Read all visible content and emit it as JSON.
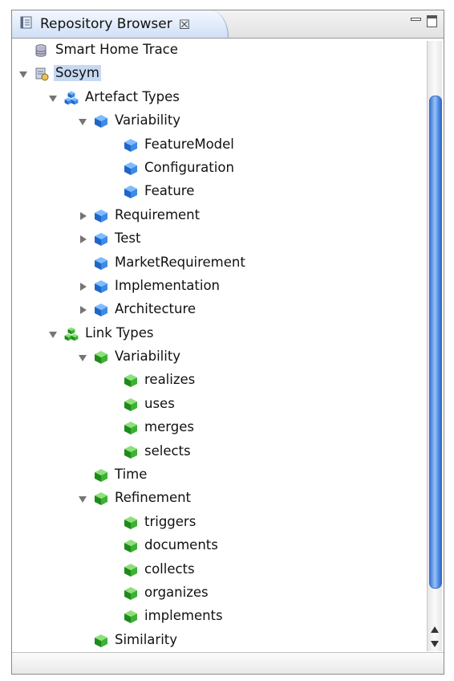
{
  "view": {
    "title": "Repository Browser",
    "title_icon": "repository-icon",
    "close_glyph": "☒",
    "controls": [
      "minimize-view",
      "maximize-view"
    ]
  },
  "tree": [
    {
      "label": "Smart Home Trace",
      "depth": 0,
      "icon": "database",
      "toggle": "none"
    },
    {
      "label": "Sosym",
      "depth": 0,
      "icon": "repository",
      "toggle": "open",
      "selected": true
    },
    {
      "label": "Artefact Types",
      "depth": 1,
      "icon": "blue-group",
      "toggle": "open"
    },
    {
      "label": "Variability",
      "depth": 2,
      "icon": "blue-cube",
      "toggle": "open"
    },
    {
      "label": "FeatureModel",
      "depth": 3,
      "icon": "blue-cube",
      "toggle": "none"
    },
    {
      "label": "Configuration",
      "depth": 3,
      "icon": "blue-cube",
      "toggle": "none"
    },
    {
      "label": "Feature",
      "depth": 3,
      "icon": "blue-cube",
      "toggle": "none"
    },
    {
      "label": "Requirement",
      "depth": 2,
      "icon": "blue-cube",
      "toggle": "closed"
    },
    {
      "label": "Test",
      "depth": 2,
      "icon": "blue-cube",
      "toggle": "closed"
    },
    {
      "label": "MarketRequirement",
      "depth": 2,
      "icon": "blue-cube",
      "toggle": "none"
    },
    {
      "label": "Implementation",
      "depth": 2,
      "icon": "blue-cube",
      "toggle": "closed"
    },
    {
      "label": "Architecture",
      "depth": 2,
      "icon": "blue-cube",
      "toggle": "closed"
    },
    {
      "label": "Link Types",
      "depth": 1,
      "icon": "green-group",
      "toggle": "open"
    },
    {
      "label": "Variability",
      "depth": 2,
      "icon": "green-cube",
      "toggle": "open"
    },
    {
      "label": "realizes",
      "depth": 3,
      "icon": "green-cube",
      "toggle": "none"
    },
    {
      "label": "uses",
      "depth": 3,
      "icon": "green-cube",
      "toggle": "none"
    },
    {
      "label": "merges",
      "depth": 3,
      "icon": "green-cube",
      "toggle": "none"
    },
    {
      "label": "selects",
      "depth": 3,
      "icon": "green-cube",
      "toggle": "none"
    },
    {
      "label": "Time",
      "depth": 2,
      "icon": "green-cube",
      "toggle": "none"
    },
    {
      "label": "Refinement",
      "depth": 2,
      "icon": "green-cube",
      "toggle": "open"
    },
    {
      "label": "triggers",
      "depth": 3,
      "icon": "green-cube",
      "toggle": "none"
    },
    {
      "label": "documents",
      "depth": 3,
      "icon": "green-cube",
      "toggle": "none"
    },
    {
      "label": "collects",
      "depth": 3,
      "icon": "green-cube",
      "toggle": "none"
    },
    {
      "label": "organizes",
      "depth": 3,
      "icon": "green-cube",
      "toggle": "none"
    },
    {
      "label": "implements",
      "depth": 3,
      "icon": "green-cube",
      "toggle": "none"
    },
    {
      "label": "Similarity",
      "depth": 2,
      "icon": "green-cube",
      "toggle": "none"
    }
  ],
  "colors": {
    "selection": "#c6d8f2",
    "blue_cube": "#2f7fe0",
    "green_cube": "#33a52a",
    "scroll_thumb": "#3d78d8"
  }
}
